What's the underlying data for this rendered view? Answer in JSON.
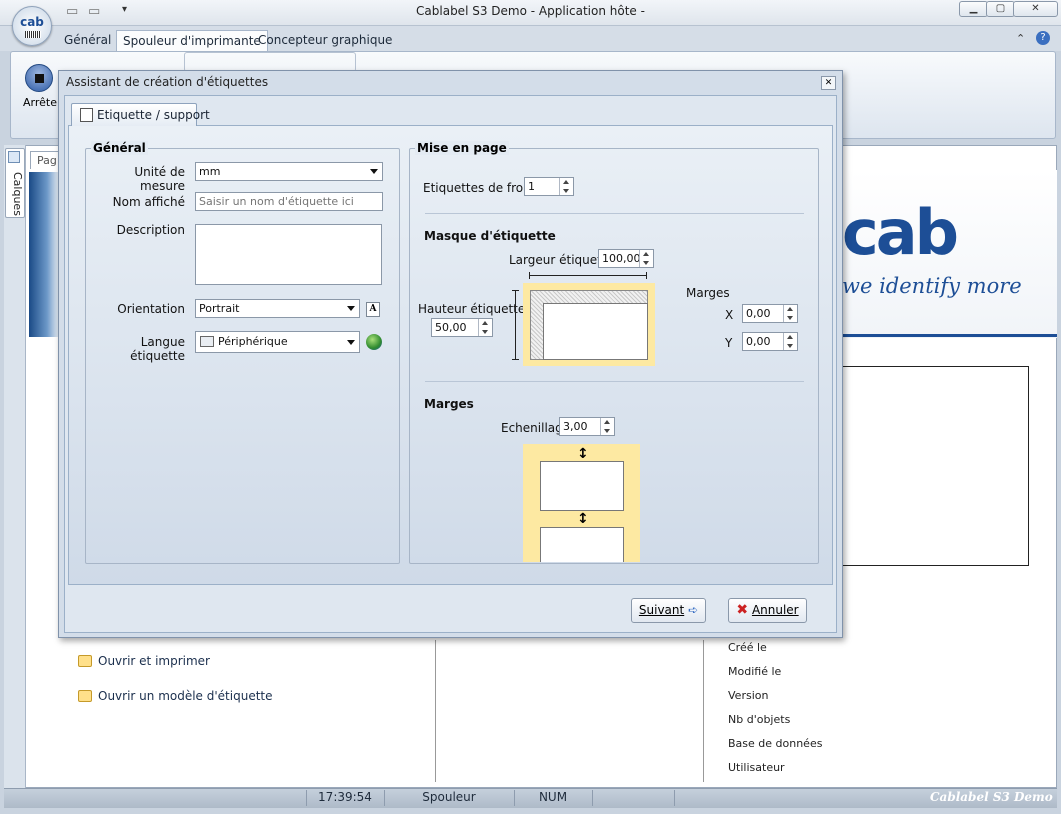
{
  "window": {
    "title": "Cablabel S3 Demo  - Application hôte -",
    "logo_text": "cab",
    "min_icon": "minimize-icon",
    "max_icon": "maximize-icon",
    "close_icon": "close-icon",
    "close_glyph": "✕"
  },
  "ribbon": {
    "tabs": [
      "Général",
      "Spouleur d'imprimante",
      "Concepteur graphique"
    ],
    "active_tab": "Spouleur d'imprimante",
    "stop_label": "Arrêter"
  },
  "side_panel": {
    "calques_label": "Calques",
    "page_tab": "Pag"
  },
  "banner": {
    "logo": "cab",
    "slogan": "we identify more"
  },
  "links": [
    {
      "label": "Ouvrir et imprimer"
    },
    {
      "label": "Ouvrir un modèle d'étiquette"
    }
  ],
  "properties": [
    "Créé le",
    "Modifié le",
    "Version",
    "Nb d'objets",
    "Base de données",
    "Utilisateur"
  ],
  "statusbar": {
    "time": "17:39:54",
    "mode": "Spouleur",
    "num": "NUM",
    "brand": "Cablabel S3 Demo"
  },
  "dialog": {
    "title": "Assistant de création d'étiquettes",
    "tab_label": "Etiquette / support",
    "general": {
      "title": "Général",
      "unit_label": "Unité de mesure",
      "unit_value": "mm",
      "name_label": "Nom affiché",
      "name_placeholder": "Saisir un nom d'étiquette ici",
      "description_label": "Description",
      "description_value": "",
      "orientation_label": "Orientation",
      "orientation_value": "Portrait",
      "language_label": "Langue étiquette",
      "language_value": "Périphérique"
    },
    "layout": {
      "title": "Mise en page",
      "front_label": "Etiquettes de front",
      "front_value": "1",
      "mask_title": "Masque d'étiquette",
      "width_label": "Largeur étiquette",
      "width_value": "100,00",
      "height_label": "Hauteur étiquette",
      "height_value": "50,00",
      "margins_label": "Marges",
      "x_label": "X",
      "x_value": "0,00",
      "y_label": "Y",
      "y_value": "0,00",
      "margins_title": "Marges",
      "gap_label": "Echenillage",
      "gap_value": "3,00"
    },
    "buttons": {
      "next": "Suivant",
      "cancel": "Annuler"
    },
    "accent_color": "#fde9a2"
  }
}
